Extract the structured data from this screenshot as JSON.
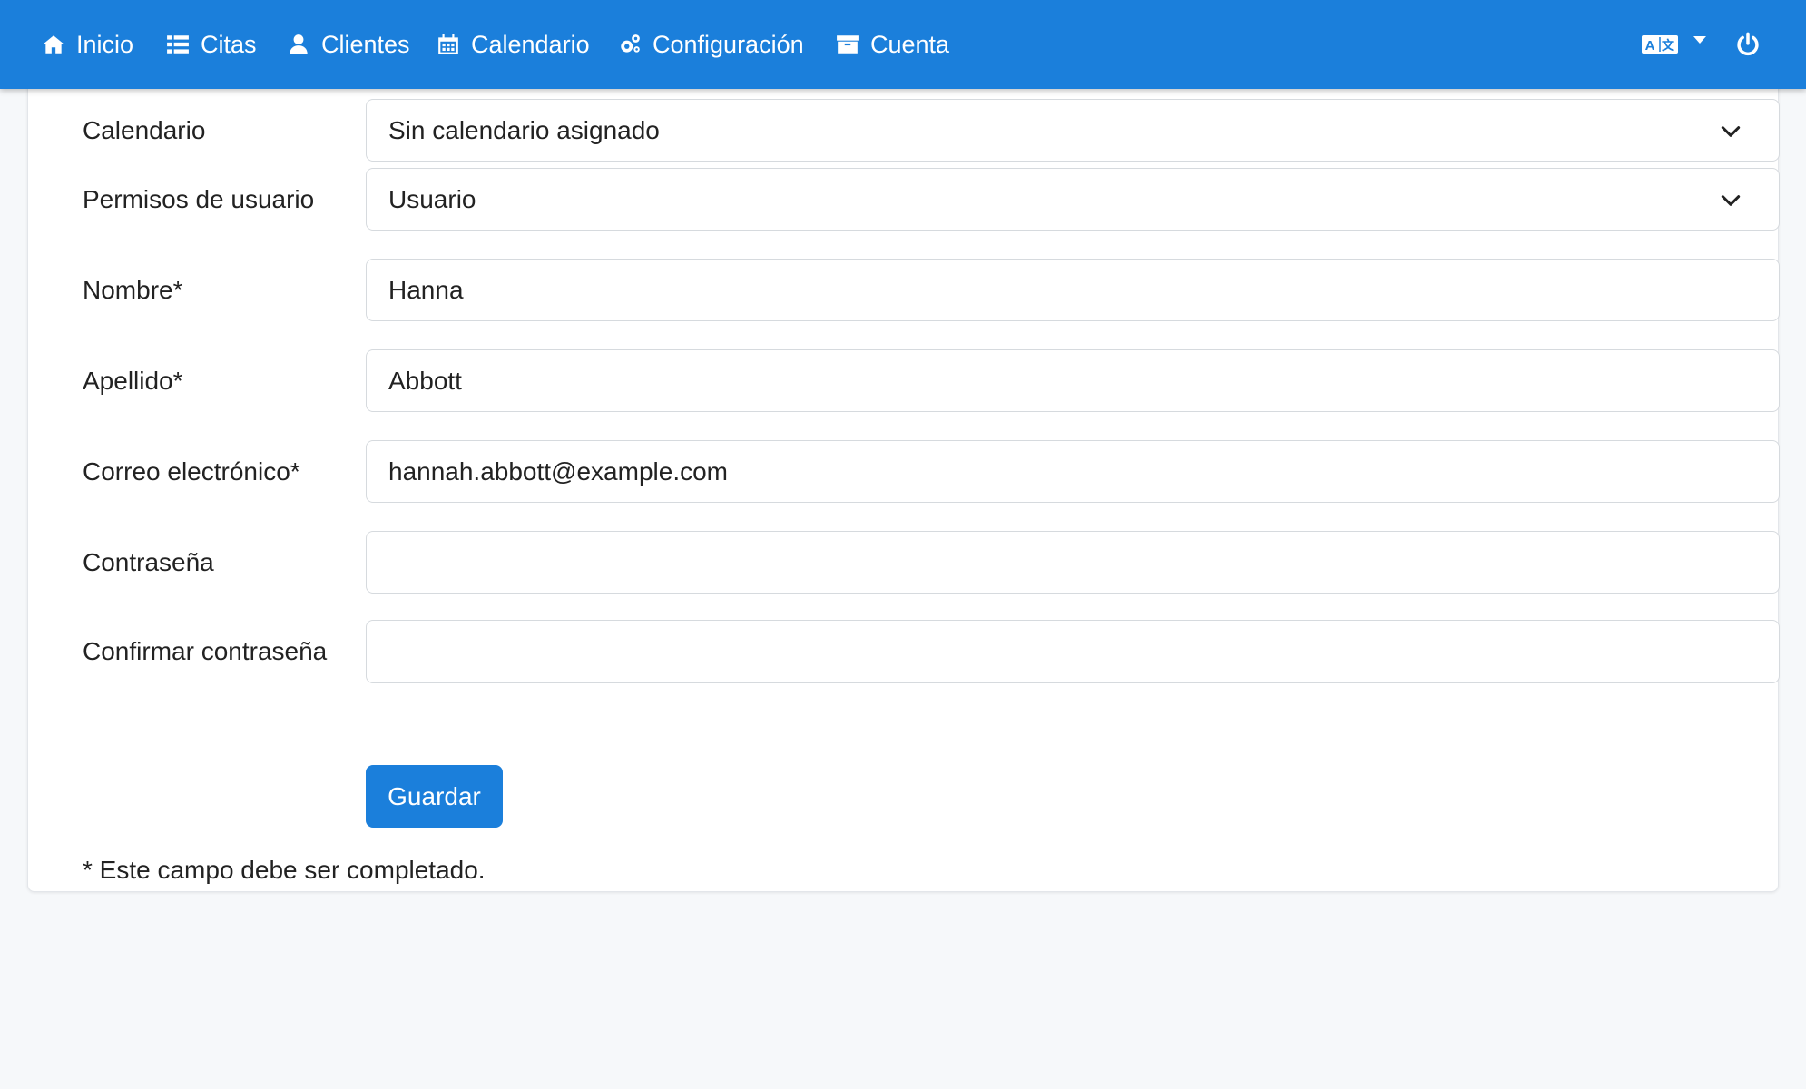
{
  "nav": {
    "items": [
      {
        "label": "Inicio",
        "icon": "home-icon"
      },
      {
        "label": "Citas",
        "icon": "list-icon"
      },
      {
        "label": "Clientes",
        "icon": "user-icon"
      },
      {
        "label": "Calendario",
        "icon": "calendar-icon"
      },
      {
        "label": "Configuración",
        "icon": "cogs-icon"
      },
      {
        "label": "Cuenta",
        "icon": "archive-icon"
      }
    ],
    "language_icon": "language-icon",
    "logout_icon": "power-icon",
    "bar_color": "#1b7fdb"
  },
  "form": {
    "calendar": {
      "label": "Calendario",
      "value": "Sin calendario asignado"
    },
    "permissions": {
      "label": "Permisos de usuario",
      "value": "Usuario"
    },
    "first_name": {
      "label": "Nombre*",
      "value": "Hanna"
    },
    "last_name": {
      "label": "Apellido*",
      "value": "Abbott"
    },
    "email": {
      "label": "Correo electrónico*",
      "value": "hannah.abbott@example.com"
    },
    "password": {
      "label": "Contraseña",
      "value": ""
    },
    "confirm_password": {
      "label": "Confirmar contraseña",
      "value": ""
    },
    "save_label": "Guardar",
    "required_note": "* Este campo debe ser completado."
  }
}
